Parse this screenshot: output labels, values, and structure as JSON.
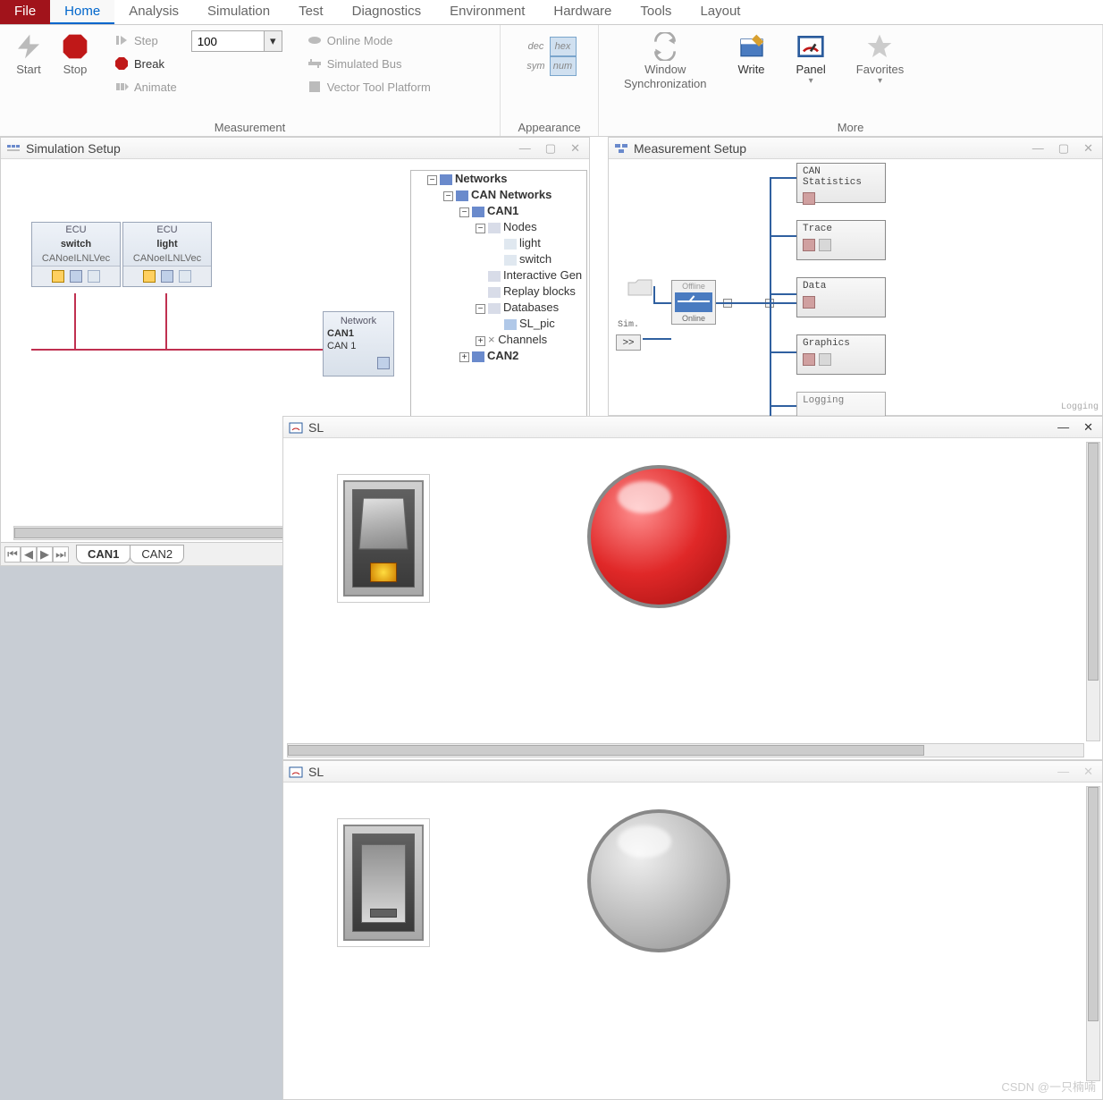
{
  "menubar": {
    "file": "File",
    "tabs": [
      "Home",
      "Analysis",
      "Simulation",
      "Test",
      "Diagnostics",
      "Environment",
      "Hardware",
      "Tools",
      "Layout"
    ],
    "active_index": 0
  },
  "ribbon": {
    "measurement": {
      "label": "Measurement",
      "start": "Start",
      "stop": "Stop",
      "step": "Step",
      "step_value": "100",
      "break": "Break",
      "animate": "Animate",
      "online_mode": "Online Mode",
      "simulated_bus": "Simulated Bus",
      "vector_tool": "Vector Tool Platform"
    },
    "appearance": {
      "label": "Appearance",
      "dec": "dec",
      "hex": "hex",
      "sym": "sym",
      "num": "num"
    },
    "more": {
      "label": "More",
      "window_sync": "Window\nSynchronization",
      "write": "Write",
      "panel": "Panel",
      "favorites": "Favorites"
    }
  },
  "sim_panel": {
    "title": "Simulation Setup",
    "ecu1": {
      "hdr": "ECU",
      "name": "switch",
      "sub": "CANoeILNLVec"
    },
    "ecu2": {
      "hdr": "ECU",
      "name": "light",
      "sub": "CANoeILNLVec"
    },
    "net": {
      "hdr": "Network",
      "name": "CAN1",
      "sub": "CAN 1"
    },
    "tree": {
      "networks": "Networks",
      "can_networks": "CAN Networks",
      "can1": "CAN1",
      "nodes": "Nodes",
      "node_light": "light",
      "node_switch": "switch",
      "interactive": "Interactive Gen",
      "replay": "Replay blocks",
      "databases": "Databases",
      "sl_pic": "SL_pic",
      "channels": "Channels",
      "can2": "CAN2"
    },
    "tabs": {
      "can1": "CAN1",
      "can2": "CAN2"
    }
  },
  "meas_panel": {
    "title": "Measurement Setup",
    "sim_label": "Sim.",
    "offline": "Offline",
    "online": "Online",
    "arrow": ">>",
    "blocks": {
      "stats": "CAN Statistics",
      "trace": "Trace",
      "data": "Data",
      "graphics": "Graphics",
      "logging": "Logging"
    },
    "logging_side": "Logging"
  },
  "sl_panel1": {
    "title": "SL"
  },
  "sl_panel2": {
    "title": "SL"
  },
  "watermark": "CSDN @一只楠喃"
}
